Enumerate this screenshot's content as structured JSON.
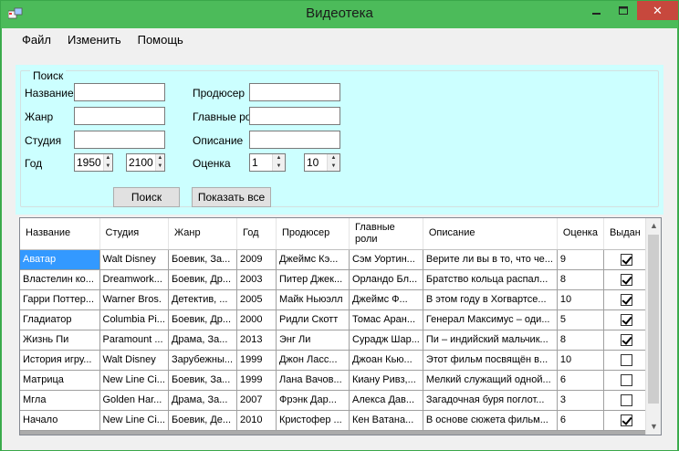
{
  "window": {
    "title": "Видеотека",
    "close_glyph": "✕"
  },
  "menu": [
    "Файл",
    "Изменить",
    "Помощь"
  ],
  "search": {
    "group_title": "Поиск",
    "name_label": "Название",
    "genre_label": "Жанр",
    "studio_label": "Студия",
    "year_label": "Год",
    "year_from": "1950",
    "year_to": "2100",
    "producer_label": "Продюсер",
    "actors_label": "Главные роли",
    "description_label": "Описание",
    "rating_label": "Оценка",
    "rating_from": "1",
    "rating_to": "10",
    "search_button": "Поиск",
    "show_all_button": "Показать все"
  },
  "grid": {
    "columns": [
      "Название",
      "Студия",
      "Жанр",
      "Год",
      "Продюсер",
      "Главные роли",
      "Описание",
      "Оценка",
      "Выдан"
    ],
    "rows": [
      {
        "title": "Аватар",
        "studio": "Walt Disney",
        "genre": "Боевик, За...",
        "year": "2009",
        "producer": "Джеймс Кэ...",
        "actors": "Сэм Уортин...",
        "description": "Верите ли вы в то, что че...",
        "rating": "9",
        "issued": true
      },
      {
        "title": "Властелин ко...",
        "studio": "Dreamwork...",
        "genre": "Боевик, Др...",
        "year": "2003",
        "producer": "Питер Джек...",
        "actors": "Орландо Бл...",
        "description": "Братство кольца распал...",
        "rating": "8",
        "issued": true
      },
      {
        "title": "Гарри Поттер...",
        "studio": "Warner Bros.",
        "genre": "Детектив, ...",
        "year": "2005",
        "producer": "Майк Ньюэлл",
        "actors": "Джеймс Ф...",
        "description": "В этом году в Хогвартсе...",
        "rating": "10",
        "issued": true
      },
      {
        "title": "Гладиатор",
        "studio": "Columbia Pi...",
        "genre": "Боевик, Др...",
        "year": "2000",
        "producer": "Ридли Скотт",
        "actors": "Томас Аран...",
        "description": "Генерал Максимус – оди...",
        "rating": "5",
        "issued": true
      },
      {
        "title": "Жизнь Пи",
        "studio": "Paramount ...",
        "genre": "Драма, За...",
        "year": "2013",
        "producer": "Энг Ли",
        "actors": "Сурадж Шар...",
        "description": "Пи – индийский мальчик...",
        "rating": "8",
        "issued": true
      },
      {
        "title": "История игру...",
        "studio": "Walt Disney",
        "genre": "Зарубежны...",
        "year": "1999",
        "producer": "Джон Ласс...",
        "actors": "Джоан Кью...",
        "description": "Этот фильм посвящён в...",
        "rating": "10",
        "issued": false
      },
      {
        "title": "Матрица",
        "studio": "New Line Ci...",
        "genre": "Боевик, За...",
        "year": "1999",
        "producer": "Лана Вачов...",
        "actors": "Киану Ривз,...",
        "description": "Мелкий служащий одной...",
        "rating": "6",
        "issued": false
      },
      {
        "title": "Мгла",
        "studio": "Golden Har...",
        "genre": "Драма, За...",
        "year": "2007",
        "producer": "Фрэнк Дар...",
        "actors": "Алекса Дав...",
        "description": "Загадочная буря поглот...",
        "rating": "3",
        "issued": false
      },
      {
        "title": "Начало",
        "studio": "New Line Ci...",
        "genre": "Боевик, Де...",
        "year": "2010",
        "producer": "Кристофер ...",
        "actors": "Кен Ватана...",
        "description": "В основе сюжета фильм...",
        "rating": "6",
        "issued": true
      }
    ]
  },
  "colors": {
    "titlebar": "#4cbb5a",
    "close": "#c7483d",
    "search_panel": "#ccffff",
    "selection": "#3399ff"
  }
}
